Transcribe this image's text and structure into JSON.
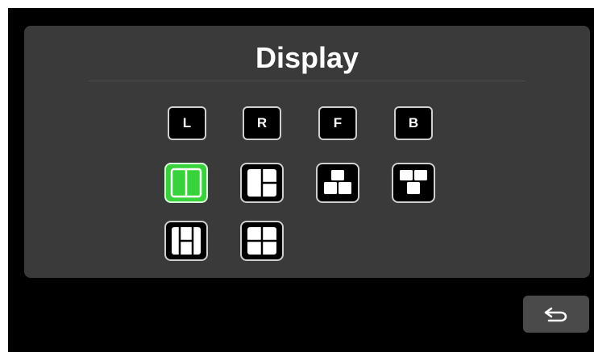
{
  "header": {
    "title": "Display"
  },
  "camera_buttons": [
    {
      "label": "L"
    },
    {
      "label": "R"
    },
    {
      "label": "F"
    },
    {
      "label": "B"
    }
  ],
  "layout_buttons": [
    {
      "name": "split-two-vertical",
      "selected": true
    },
    {
      "name": "one-large-two-small-right",
      "selected": false
    },
    {
      "name": "one-top-two-bottom",
      "selected": false
    },
    {
      "name": "two-top-one-bottom",
      "selected": false
    },
    {
      "name": "one-large-center-two-sides",
      "selected": false
    },
    {
      "name": "quad-grid",
      "selected": false
    }
  ],
  "colors": {
    "selected": "#38d23a",
    "panel": "#3a3a3a",
    "background": "#000000"
  },
  "footer": {
    "back_icon": "return-arrow-icon"
  }
}
